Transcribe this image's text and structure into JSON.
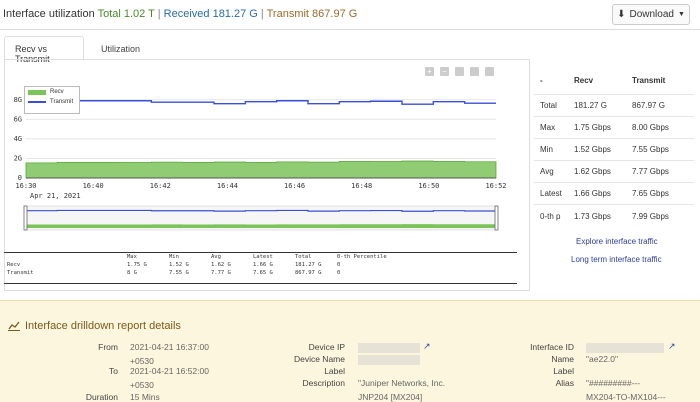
{
  "header": {
    "title": "Interface utilization",
    "total": "Total 1.02 T",
    "sep": "|",
    "received": "Received 181.27 G",
    "transmit": "Transmit 867.97 G",
    "download_label": "Download"
  },
  "tabs": [
    {
      "label": "Recv vs Transmit",
      "active": true
    },
    {
      "label": "Utilization",
      "active": false
    }
  ],
  "chart_data": {
    "type": "area",
    "y_ticks": [
      "8G",
      "6G",
      "4G",
      "2G",
      "0"
    ],
    "x_ticks": [
      "16:30",
      "16:40",
      "16:42",
      "16:44",
      "16:46",
      "16:48",
      "16:50",
      "16:52"
    ],
    "date_label": "Apr 21, 2021",
    "ylim": [
      0,
      9
    ],
    "y_tick_values": [
      8,
      6,
      4,
      2,
      0
    ],
    "x_tick_positions": [
      0,
      1,
      2,
      3,
      4,
      5,
      6,
      7
    ],
    "series": [
      {
        "name": "Recv",
        "color": "#7cc35a",
        "values": [
          1.55,
          1.6,
          1.6,
          1.58,
          1.62,
          1.6,
          1.63,
          1.6,
          1.65,
          1.62,
          1.7,
          1.68,
          1.73,
          1.7,
          1.66
        ]
      },
      {
        "name": "Transmit",
        "color": "#3a4fd8",
        "values": [
          7.8,
          7.9,
          7.9,
          7.9,
          7.75,
          7.75,
          7.6,
          7.8,
          7.9,
          7.6,
          7.8,
          7.85,
          7.55,
          7.8,
          7.65
        ]
      }
    ]
  },
  "stats": {
    "headers": [
      "",
      "Max",
      "Min",
      "Avg",
      "Latest",
      "Total",
      "0-th Percentile"
    ],
    "rows": [
      [
        "Recv",
        "1.75 G",
        "1.52 G",
        "1.62 G",
        "1.66 G",
        "181.27 G",
        "0"
      ],
      [
        "Transmit",
        "8 G",
        "7.55 G",
        "7.77 G",
        "7.65 G",
        "867.97 G",
        "0"
      ]
    ]
  },
  "side": {
    "headers": [
      "-",
      "Recv",
      "Transmit"
    ],
    "rows": [
      [
        "Total",
        "181.27 G",
        "867.97 G"
      ],
      [
        "Max",
        "1.75 Gbps",
        "8.00 Gbps"
      ],
      [
        "Min",
        "1.52 Gbps",
        "7.55 Gbps"
      ],
      [
        "Avg",
        "1.62 Gbps",
        "7.77 Gbps"
      ],
      [
        "Latest",
        "1.66 Gbps",
        "7.65 Gbps"
      ],
      [
        "0-th p",
        "1.73 Gbps",
        "7.99 Gbps"
      ]
    ],
    "link1": "Explore interface traffic",
    "link2": "Long term interface traffic"
  },
  "drill": {
    "title": "Interface drilldown report details",
    "from_label": "From",
    "from_value_1": "2021-04-21 16:37:00",
    "from_value_2": "+0530",
    "to_label": "To",
    "to_value_1": "2021-04-21 16:52:00",
    "to_value_2": "+0530",
    "duration_label": "Duration",
    "duration_value": "15 Mins",
    "device_ip_label": "Device IP",
    "device_name_label": "Device Name",
    "label_label": "Label",
    "description_label": "Description",
    "description_value_1": "\"Juniper Networks, Inc.",
    "description_value_2": "JNP204 [MX204]",
    "interface_id_label": "Interface ID",
    "name_label": "Name",
    "name_value": "\"ae22.0\"",
    "label2_label": "Label",
    "alias_label": "Alias",
    "alias_value_1": "\"#########---",
    "alias_value_2": "MX204-TO-MX104---"
  }
}
